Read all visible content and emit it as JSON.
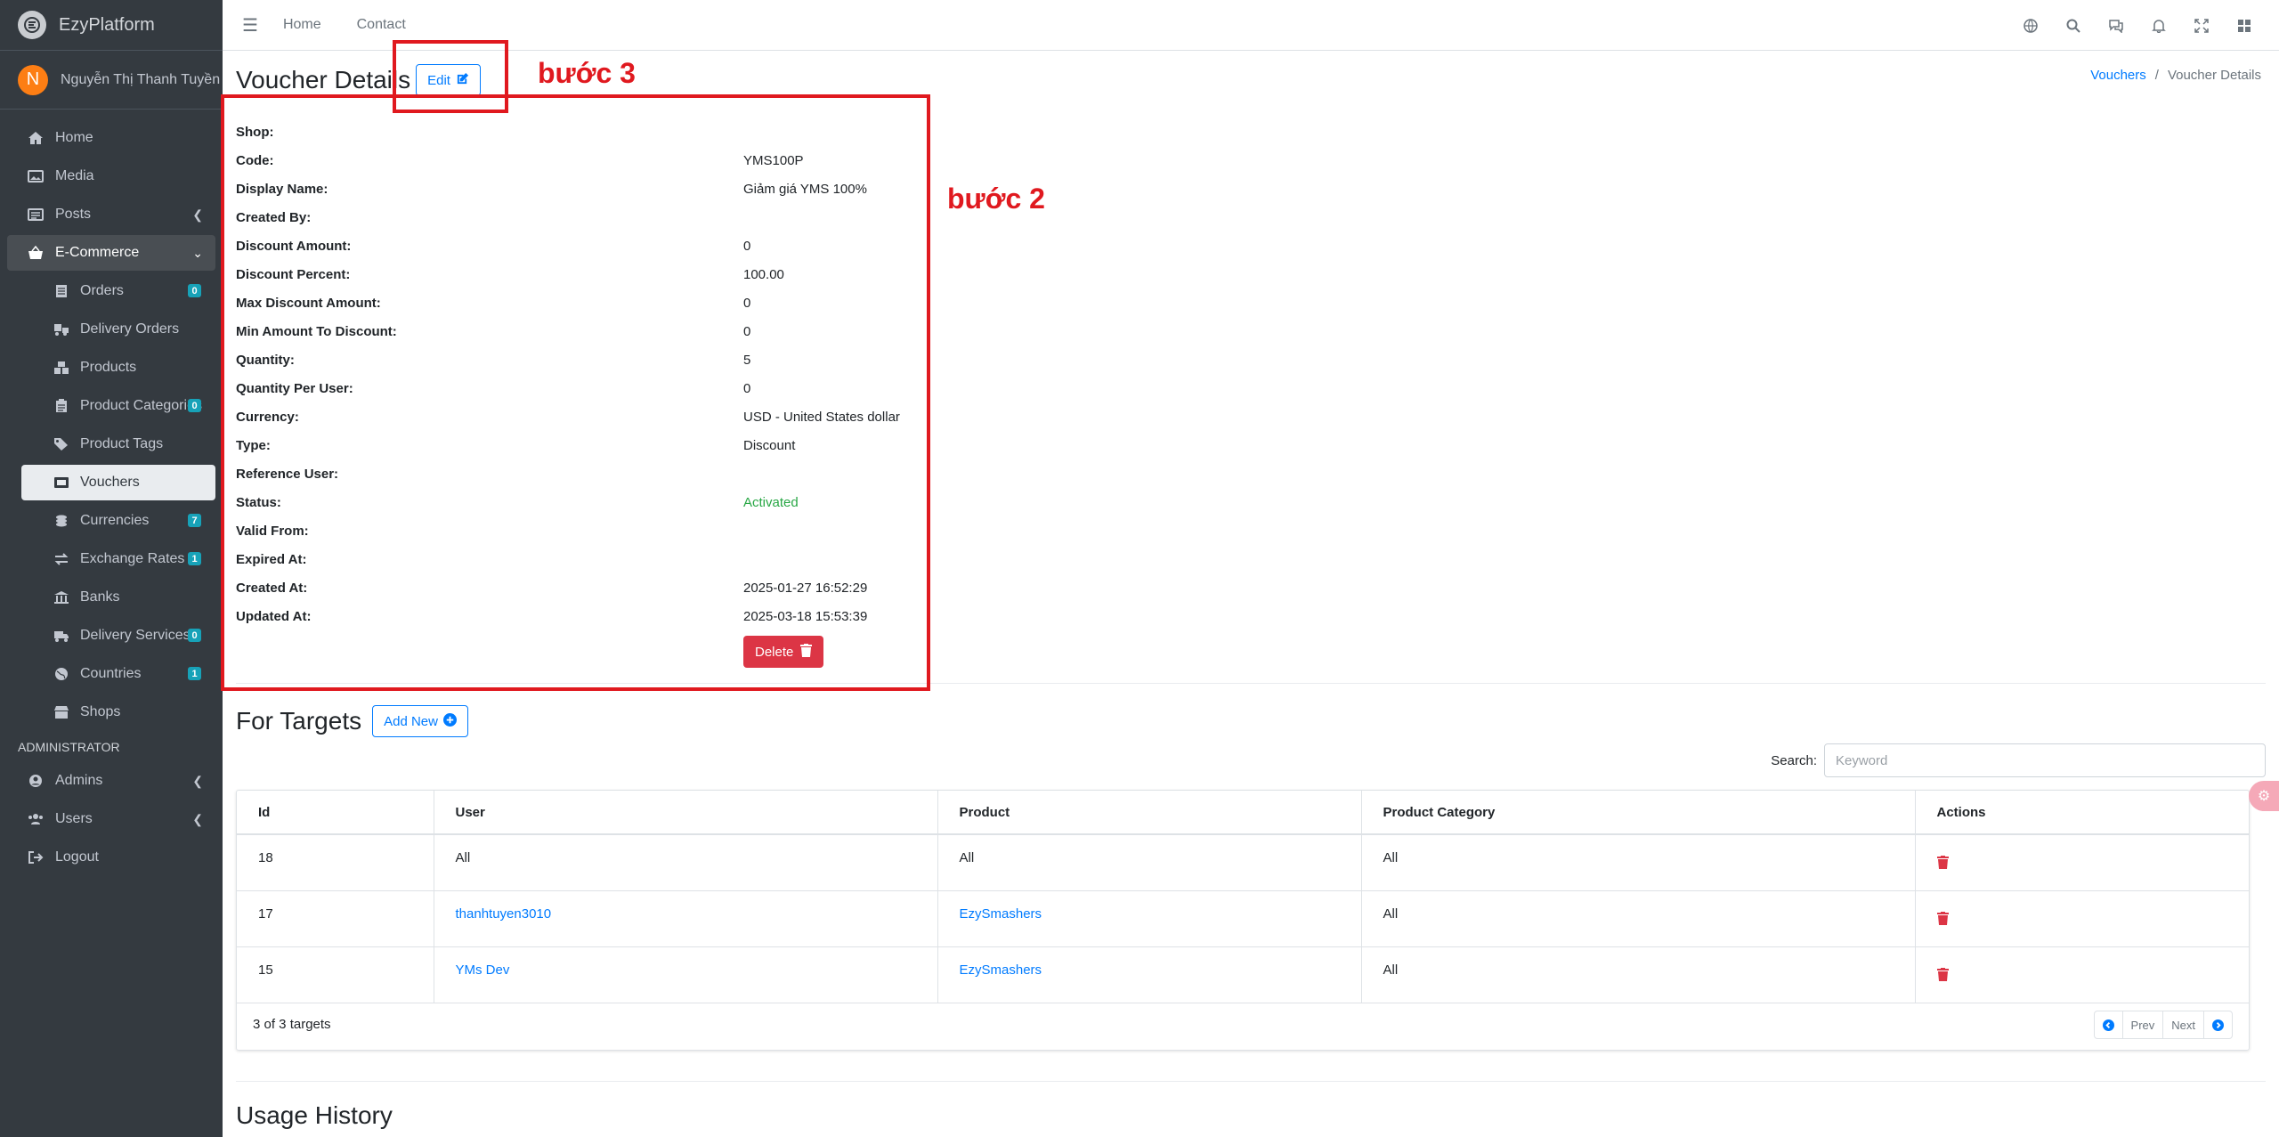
{
  "brand": {
    "name": "EzyPlatform"
  },
  "user": {
    "initial": "N",
    "name": "Nguyễn Thị Thanh Tuyền"
  },
  "sidebar": {
    "items": [
      {
        "label": "Home"
      },
      {
        "label": "Media"
      },
      {
        "label": "Posts"
      },
      {
        "label": "E-Commerce"
      }
    ],
    "ecommerce": [
      {
        "label": "Orders",
        "badge": "0"
      },
      {
        "label": "Delivery Orders"
      },
      {
        "label": "Products"
      },
      {
        "label": "Product Categories",
        "badge": "0"
      },
      {
        "label": "Product Tags"
      },
      {
        "label": "Vouchers"
      },
      {
        "label": "Currencies",
        "badge": "7"
      },
      {
        "label": "Exchange Rates",
        "badge": "1"
      },
      {
        "label": "Banks"
      },
      {
        "label": "Delivery Services",
        "badge": "0"
      },
      {
        "label": "Countries",
        "badge": "1"
      },
      {
        "label": "Shops"
      }
    ],
    "admin_header": "ADMINISTRATOR",
    "admin": [
      {
        "label": "Admins"
      },
      {
        "label": "Users"
      },
      {
        "label": "Logout"
      }
    ]
  },
  "topbar": {
    "home": "Home",
    "contact": "Contact"
  },
  "page": {
    "title": "Voucher Details",
    "edit_label": "Edit",
    "breadcrumb": {
      "parent": "Vouchers",
      "current": "Voucher Details"
    }
  },
  "details": [
    {
      "label": "Shop:",
      "value": ""
    },
    {
      "label": "Code:",
      "value": "YMS100P"
    },
    {
      "label": "Display Name:",
      "value": "Giảm giá YMS 100%"
    },
    {
      "label": "Created By:",
      "value": ""
    },
    {
      "label": "Discount Amount:",
      "value": "0"
    },
    {
      "label": "Discount Percent:",
      "value": "100.00"
    },
    {
      "label": "Max Discount Amount:",
      "value": "0"
    },
    {
      "label": "Min Amount To Discount:",
      "value": "0"
    },
    {
      "label": "Quantity:",
      "value": "5"
    },
    {
      "label": "Quantity Per User:",
      "value": "0"
    },
    {
      "label": "Currency:",
      "value": "USD - United States dollar"
    },
    {
      "label": "Type:",
      "value": "Discount"
    },
    {
      "label": "Reference User:",
      "value": ""
    },
    {
      "label": "Status:",
      "value": "Activated"
    },
    {
      "label": "Valid From:",
      "value": ""
    },
    {
      "label": "Expired At:",
      "value": ""
    },
    {
      "label": "Created At:",
      "value": "2025-01-27 16:52:29"
    },
    {
      "label": "Updated At:",
      "value": "2025-03-18 15:53:39"
    }
  ],
  "delete_label": "Delete",
  "targets": {
    "title": "For Targets",
    "add_label": "Add New",
    "search_label": "Search:",
    "search_placeholder": "Keyword",
    "columns": [
      "Id",
      "User",
      "Product",
      "Product Category",
      "Actions"
    ],
    "rows": [
      {
        "id": "18",
        "user": "All",
        "product": "All",
        "category": "All"
      },
      {
        "id": "17",
        "user": "thanhtuyen3010",
        "product": "EzySmashers",
        "category": "All"
      },
      {
        "id": "15",
        "user": "YMs Dev",
        "product": "EzySmashers",
        "category": "All"
      }
    ],
    "summary": "3 of 3 targets",
    "prev": "Prev",
    "next": "Next"
  },
  "usage": {
    "title": "Usage History"
  },
  "annotations": {
    "step2": "bước 2",
    "step3": "bước 3"
  },
  "colors": {
    "sidebar": "#343a40",
    "primary": "#007bff",
    "danger": "#dc3545",
    "success": "#28a745",
    "annotation": "#e0191f"
  }
}
